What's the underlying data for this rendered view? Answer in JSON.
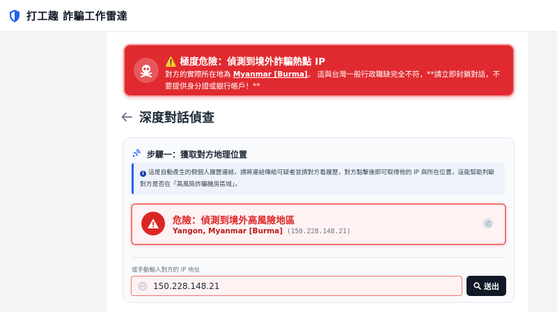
{
  "header": {
    "title": "打工趣 詐騙工作雷達"
  },
  "top_alert": {
    "title": "⚠️ 極度危險：偵測到境外詐騙熱點 IP",
    "body_prefix": "對方的實際所在地為 ",
    "location": "Myanmar [Burma]",
    "body_suffix": "。 這與台灣一般行政職缺完全不符，**請立即封鎖對話，不要提供身分證或銀行帳戶！**"
  },
  "page": {
    "back_label": "←",
    "title": "深度對話偵查"
  },
  "step1": {
    "title": "步驟一：獲取對方地理位置",
    "info_text": "這是自動產生的假個人履歷連結，請將連結傳給可疑者並請對方看履歷，對方點擊後即可取得他的 IP 與所在位置，這能幫助判斷對方是否在「高風險詐騙機房區域」。",
    "result": {
      "title": "危險：偵測到境外高風險地區",
      "location": "Yangon, Myanmar [Burma]",
      "ip": "(150.228.148.21)"
    },
    "manual_label": "或手動輸入對方的 IP 地址",
    "ip_value": "150.228.148.21",
    "submit_label": "送出"
  },
  "icons": {
    "brand": "shield-icon",
    "alert": "skull-crossbones-icon",
    "step": "satellite-dish-icon",
    "info": "info-circle-icon",
    "danger": "warning-triangle-icon",
    "refresh": "refresh-icon",
    "input": "globe-icon",
    "submit": "search-icon"
  },
  "colors": {
    "danger": "#e02a2f",
    "danger_dark": "#dc2626",
    "primary": "#2563eb",
    "button": "#111827"
  }
}
